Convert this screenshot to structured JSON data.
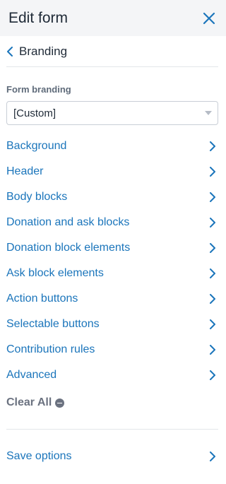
{
  "header": {
    "title": "Edit form"
  },
  "breadcrumb": {
    "label": "Branding"
  },
  "branding": {
    "section_label": "Form branding",
    "selected_value": "[Custom]"
  },
  "menu": {
    "items": [
      {
        "label": "Background"
      },
      {
        "label": "Header"
      },
      {
        "label": "Body blocks"
      },
      {
        "label": "Donation and ask blocks"
      },
      {
        "label": "Donation block elements"
      },
      {
        "label": "Ask block elements"
      },
      {
        "label": "Action buttons"
      },
      {
        "label": "Selectable buttons"
      },
      {
        "label": "Contribution rules"
      },
      {
        "label": "Advanced"
      }
    ]
  },
  "clear_all": {
    "label": "Clear All"
  },
  "save_options": {
    "label": "Save options"
  },
  "colors": {
    "accent": "#1b75bb",
    "header_bg": "#f4f5f7",
    "muted": "#6b7280"
  },
  "icons": {
    "close": "close-icon",
    "back": "chevron-left-icon",
    "item": "chevron-right-icon",
    "clear": "minus-circle-icon",
    "dropdown": "caret-down-icon"
  }
}
